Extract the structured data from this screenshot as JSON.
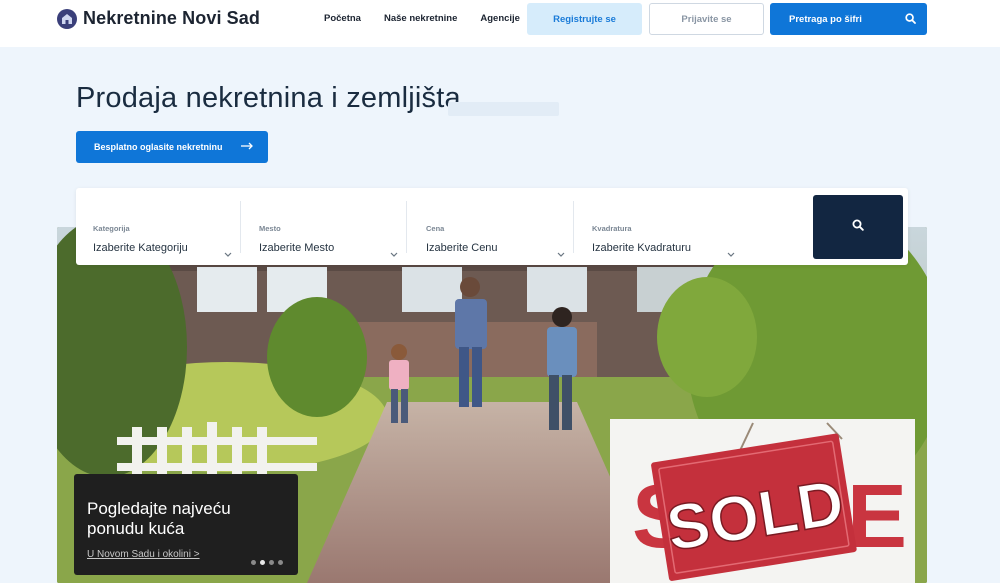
{
  "header": {
    "brand": "Nekretnine Novi Sad",
    "nav": [
      {
        "label": "Početna"
      },
      {
        "label": "Naše nekretnine"
      },
      {
        "label": "Agencije"
      }
    ],
    "register_label": "Registrujte se",
    "login_label": "Prijavite se",
    "search_code_label": "Pretraga po šifri"
  },
  "hero": {
    "title": "Prodaja nekretnina i zemljišta",
    "advertise_label": "Besplatno oglasite nekretninu"
  },
  "search": {
    "fields": [
      {
        "label": "Kategorija",
        "value": "Izaberite Kategoriju"
      },
      {
        "label": "Mesto",
        "value": "Izaberite Mesto"
      },
      {
        "label": "Cena",
        "value": "Izaberite Cenu"
      },
      {
        "label": "Kvadratura",
        "value": "Izaberite Kvadraturu"
      }
    ]
  },
  "slide": {
    "title": "Pogledajte najveću ponudu kuća",
    "link": "U Novom Sadu i okolini >",
    "sign_text": "SOLD",
    "dots": 4,
    "active_dot": 2
  },
  "colors": {
    "primary": "#0f76d8",
    "primary_light": "#d6ecfb",
    "dark_navy": "#122641",
    "background": "#eef5fc"
  }
}
